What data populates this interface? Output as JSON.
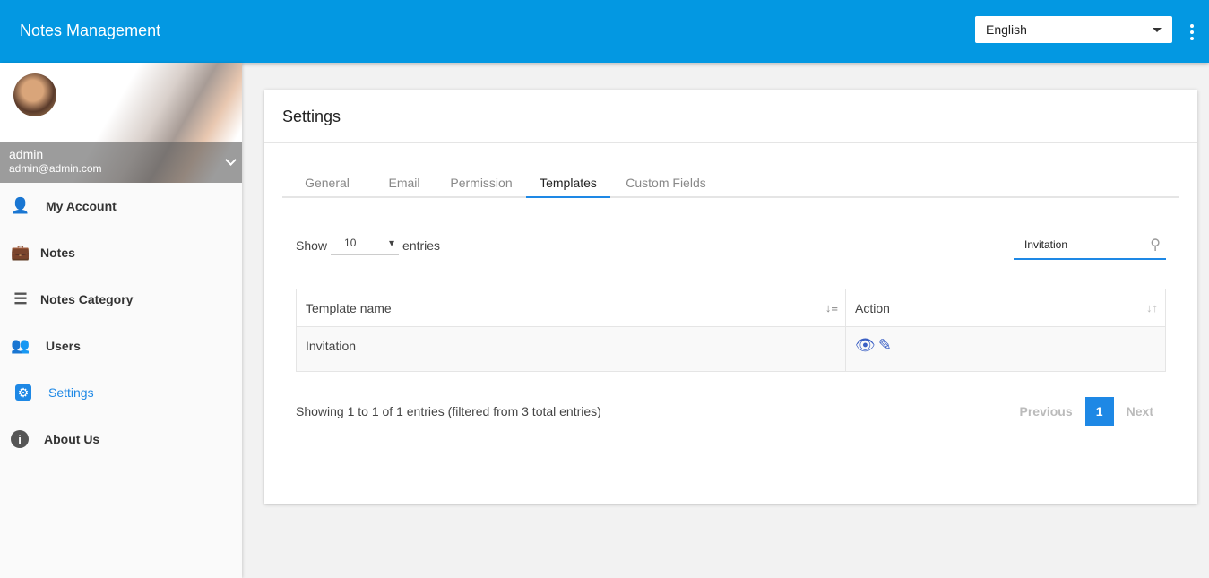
{
  "app": {
    "title": "Notes Management",
    "language": "English"
  },
  "user": {
    "name": "admin",
    "email": "admin@admin.com"
  },
  "sidebar": {
    "items": [
      {
        "label": "My Account",
        "icon": "person-icon"
      },
      {
        "label": "Notes",
        "icon": "briefcase-icon"
      },
      {
        "label": "Notes Category",
        "icon": "category-icon"
      },
      {
        "label": "Users",
        "icon": "users-icon"
      },
      {
        "label": "Settings",
        "icon": "gear-icon",
        "active": true
      },
      {
        "label": "About Us",
        "icon": "info-icon"
      }
    ]
  },
  "page": {
    "title": "Settings",
    "tabs": [
      "General",
      "Email",
      "Permission",
      "Templates",
      "Custom Fields"
    ],
    "active_tab": "Templates",
    "show_label": "Show",
    "entries_value": "10",
    "entries_label": "entries",
    "search_value": "Invitation",
    "table": {
      "headers": [
        "Template name",
        "Action"
      ],
      "rows": [
        {
          "name": "Invitation"
        }
      ]
    },
    "info": "Showing 1 to 1 of 1 entries (filtered from 3 total entries)",
    "pager": {
      "previous": "Previous",
      "current": "1",
      "next": "Next"
    }
  }
}
